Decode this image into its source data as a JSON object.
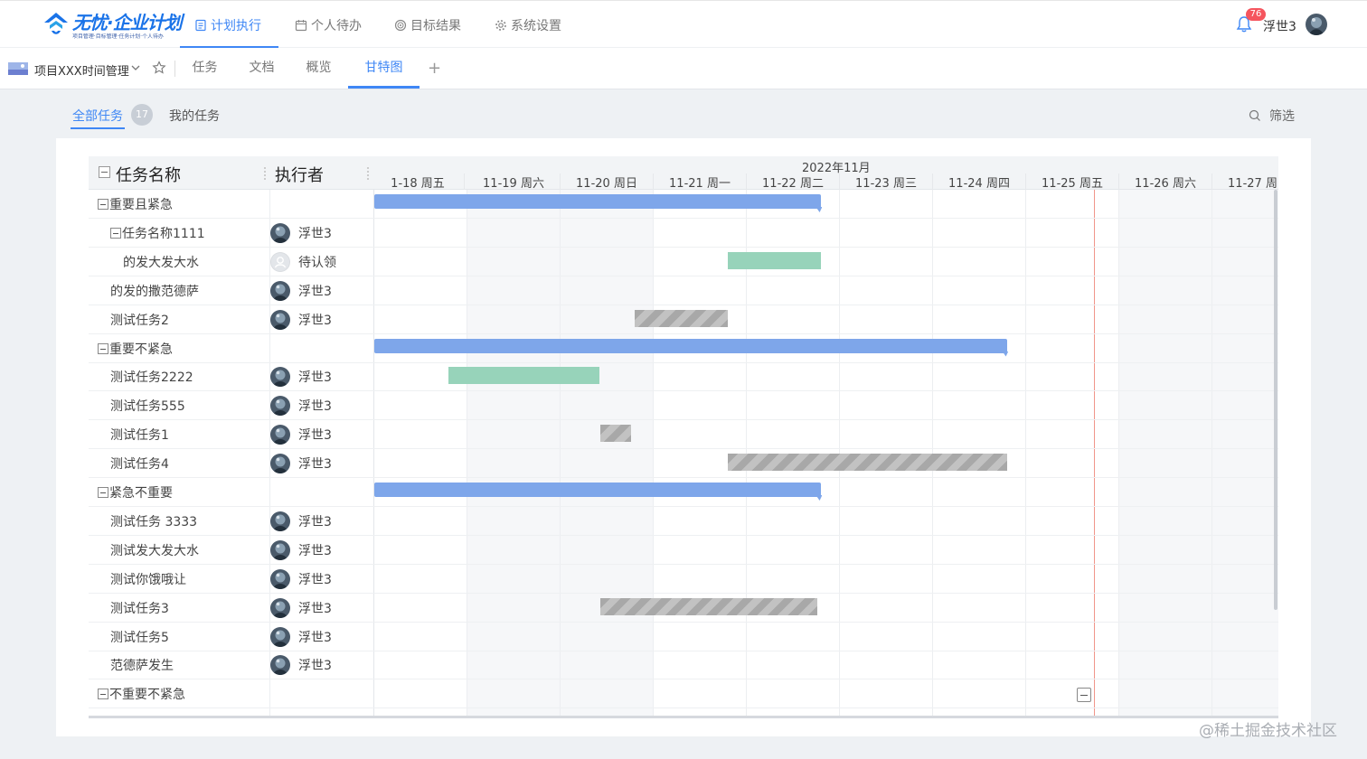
{
  "app": {
    "logo_text": "无忧·企业计划",
    "logo_sub": "项目管理·目标管理·任务计划·个人待办",
    "brand_color": "#3f87f5"
  },
  "nav": {
    "items": [
      {
        "label": "计划执行",
        "icon": "document-icon",
        "active": true
      },
      {
        "label": "个人待办",
        "icon": "calendar-icon",
        "active": false
      },
      {
        "label": "目标结果",
        "icon": "target-icon",
        "active": false
      },
      {
        "label": "系统设置",
        "icon": "gear-icon",
        "active": false
      }
    ],
    "notification_count": "76",
    "user_name": "浮世3"
  },
  "project": {
    "name": "项目XXX时间管理",
    "tabs": [
      {
        "label": "任务",
        "active": false
      },
      {
        "label": "文档",
        "active": false
      },
      {
        "label": "概览",
        "active": false
      },
      {
        "label": "甘特图",
        "active": true
      }
    ],
    "add_tab": "+"
  },
  "filter": {
    "all_tasks": "全部任务",
    "all_count": "17",
    "my_tasks": "我的任务",
    "filter_label": "筛选"
  },
  "gantt": {
    "col_name": "任务名称",
    "col_exec": "执行者",
    "month": "2022年11月",
    "days": [
      "1-18 周五",
      "11-19 周六",
      "11-20 周日",
      "11-21 周一",
      "11-22 周二",
      "11-23 周三",
      "11-24 周四",
      "11-25 周五",
      "11-26 周六",
      "11-27 周日"
    ],
    "rows": [
      {
        "type": "group",
        "name": "重要且紧急",
        "bar": {
          "kind": "group",
          "start": 0,
          "end": 4.8
        }
      },
      {
        "type": "parent",
        "name": "任务名称1111",
        "exec": "浮世3"
      },
      {
        "type": "child",
        "name": "的发大发大水",
        "exec": "待认领",
        "pending": true,
        "bar": {
          "kind": "green",
          "start": 3.8,
          "end": 4.8
        }
      },
      {
        "type": "task",
        "name": "的发的撒范德萨",
        "exec": "浮世3"
      },
      {
        "type": "task",
        "name": "测试任务2",
        "exec": "浮世3",
        "bar": {
          "kind": "gray",
          "start": 2.8,
          "end": 3.8
        }
      },
      {
        "type": "group",
        "name": "重要不紧急",
        "bar": {
          "kind": "group",
          "start": 0,
          "end": 6.8
        }
      },
      {
        "type": "task",
        "name": "测试任务2222",
        "exec": "浮世3",
        "bar": {
          "kind": "green",
          "start": 0.8,
          "end": 2.42
        }
      },
      {
        "type": "task",
        "name": "测试任务555",
        "exec": "浮世3"
      },
      {
        "type": "task",
        "name": "测试任务1",
        "exec": "浮世3",
        "bar": {
          "kind": "gray",
          "start": 2.43,
          "end": 2.76
        }
      },
      {
        "type": "task",
        "name": "测试任务4",
        "exec": "浮世3",
        "bar": {
          "kind": "gray",
          "start": 3.8,
          "end": 6.8
        }
      },
      {
        "type": "group",
        "name": "紧急不重要",
        "bar": {
          "kind": "group",
          "start": 0,
          "end": 4.8
        }
      },
      {
        "type": "task",
        "name": "测试任务 3333",
        "exec": "浮世3"
      },
      {
        "type": "task",
        "name": "测试发大发大水",
        "exec": "浮世3"
      },
      {
        "type": "task",
        "name": "测试你饿哦让",
        "exec": "浮世3"
      },
      {
        "type": "task",
        "name": "测试任务3",
        "exec": "浮世3",
        "bar": {
          "kind": "gray",
          "start": 2.43,
          "end": 4.76
        }
      },
      {
        "type": "task",
        "name": "测试任务5",
        "exec": "浮世3"
      },
      {
        "type": "task",
        "name": "范德萨发生",
        "exec": "浮世3"
      },
      {
        "type": "group",
        "name": "不重要不紧急"
      }
    ]
  },
  "watermark": "@稀土掘金技术社区"
}
